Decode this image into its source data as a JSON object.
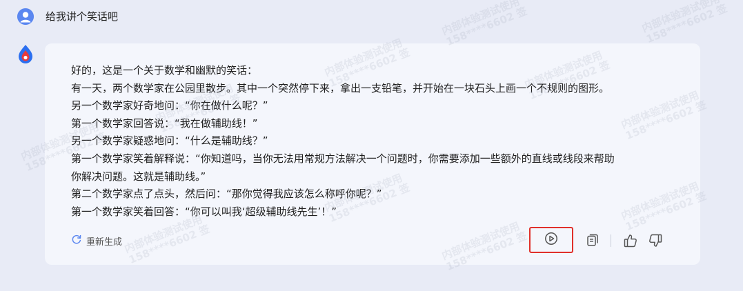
{
  "user": {
    "question": "给我讲个笑话吧",
    "avatar_icon": "user-avatar-icon"
  },
  "bot": {
    "avatar_icon": "assistant-logo-icon"
  },
  "answer": {
    "lines": [
      "好的，这是一个关于数学和幽默的笑话：",
      "有一天，两个数学家在公园里散步。其中一个突然停下来，拿出一支铅笔，并开始在一块石头上画一个不规则的图形。",
      "另一个数学家好奇地问：“你在做什么呢？”",
      "第一个数学家回答说：“我在做辅助线！”",
      "另一个数学家疑惑地问：“什么是辅助线？”",
      "第一个数学家笑着解释说：“你知道吗，当你无法用常规方法解决一个问题时，你需要添加一些额外的直线或线段来帮助",
      "你解决问题。这就是辅助线。”",
      "第二个数学家点了点头，然后问：“那你觉得我应该怎么称呼你呢？”",
      "第一个数学家笑着回答：“你可以叫我‘超级辅助线先生’！”"
    ]
  },
  "actions": {
    "regenerate_label": "重新生成",
    "regenerate_icon": "refresh-icon",
    "play_icon": "play-circle-icon",
    "copy_icon": "copy-icon",
    "like_icon": "thumbs-up-icon",
    "dislike_icon": "thumbs-down-icon",
    "highlight_color": "#e0302b"
  },
  "watermark": {
    "line1": "内部体验测试使用",
    "line2": "158****6602 签"
  },
  "colors": {
    "background": "#e8ebf6",
    "card": "#f4f6fc",
    "accent": "#5b87f0"
  }
}
